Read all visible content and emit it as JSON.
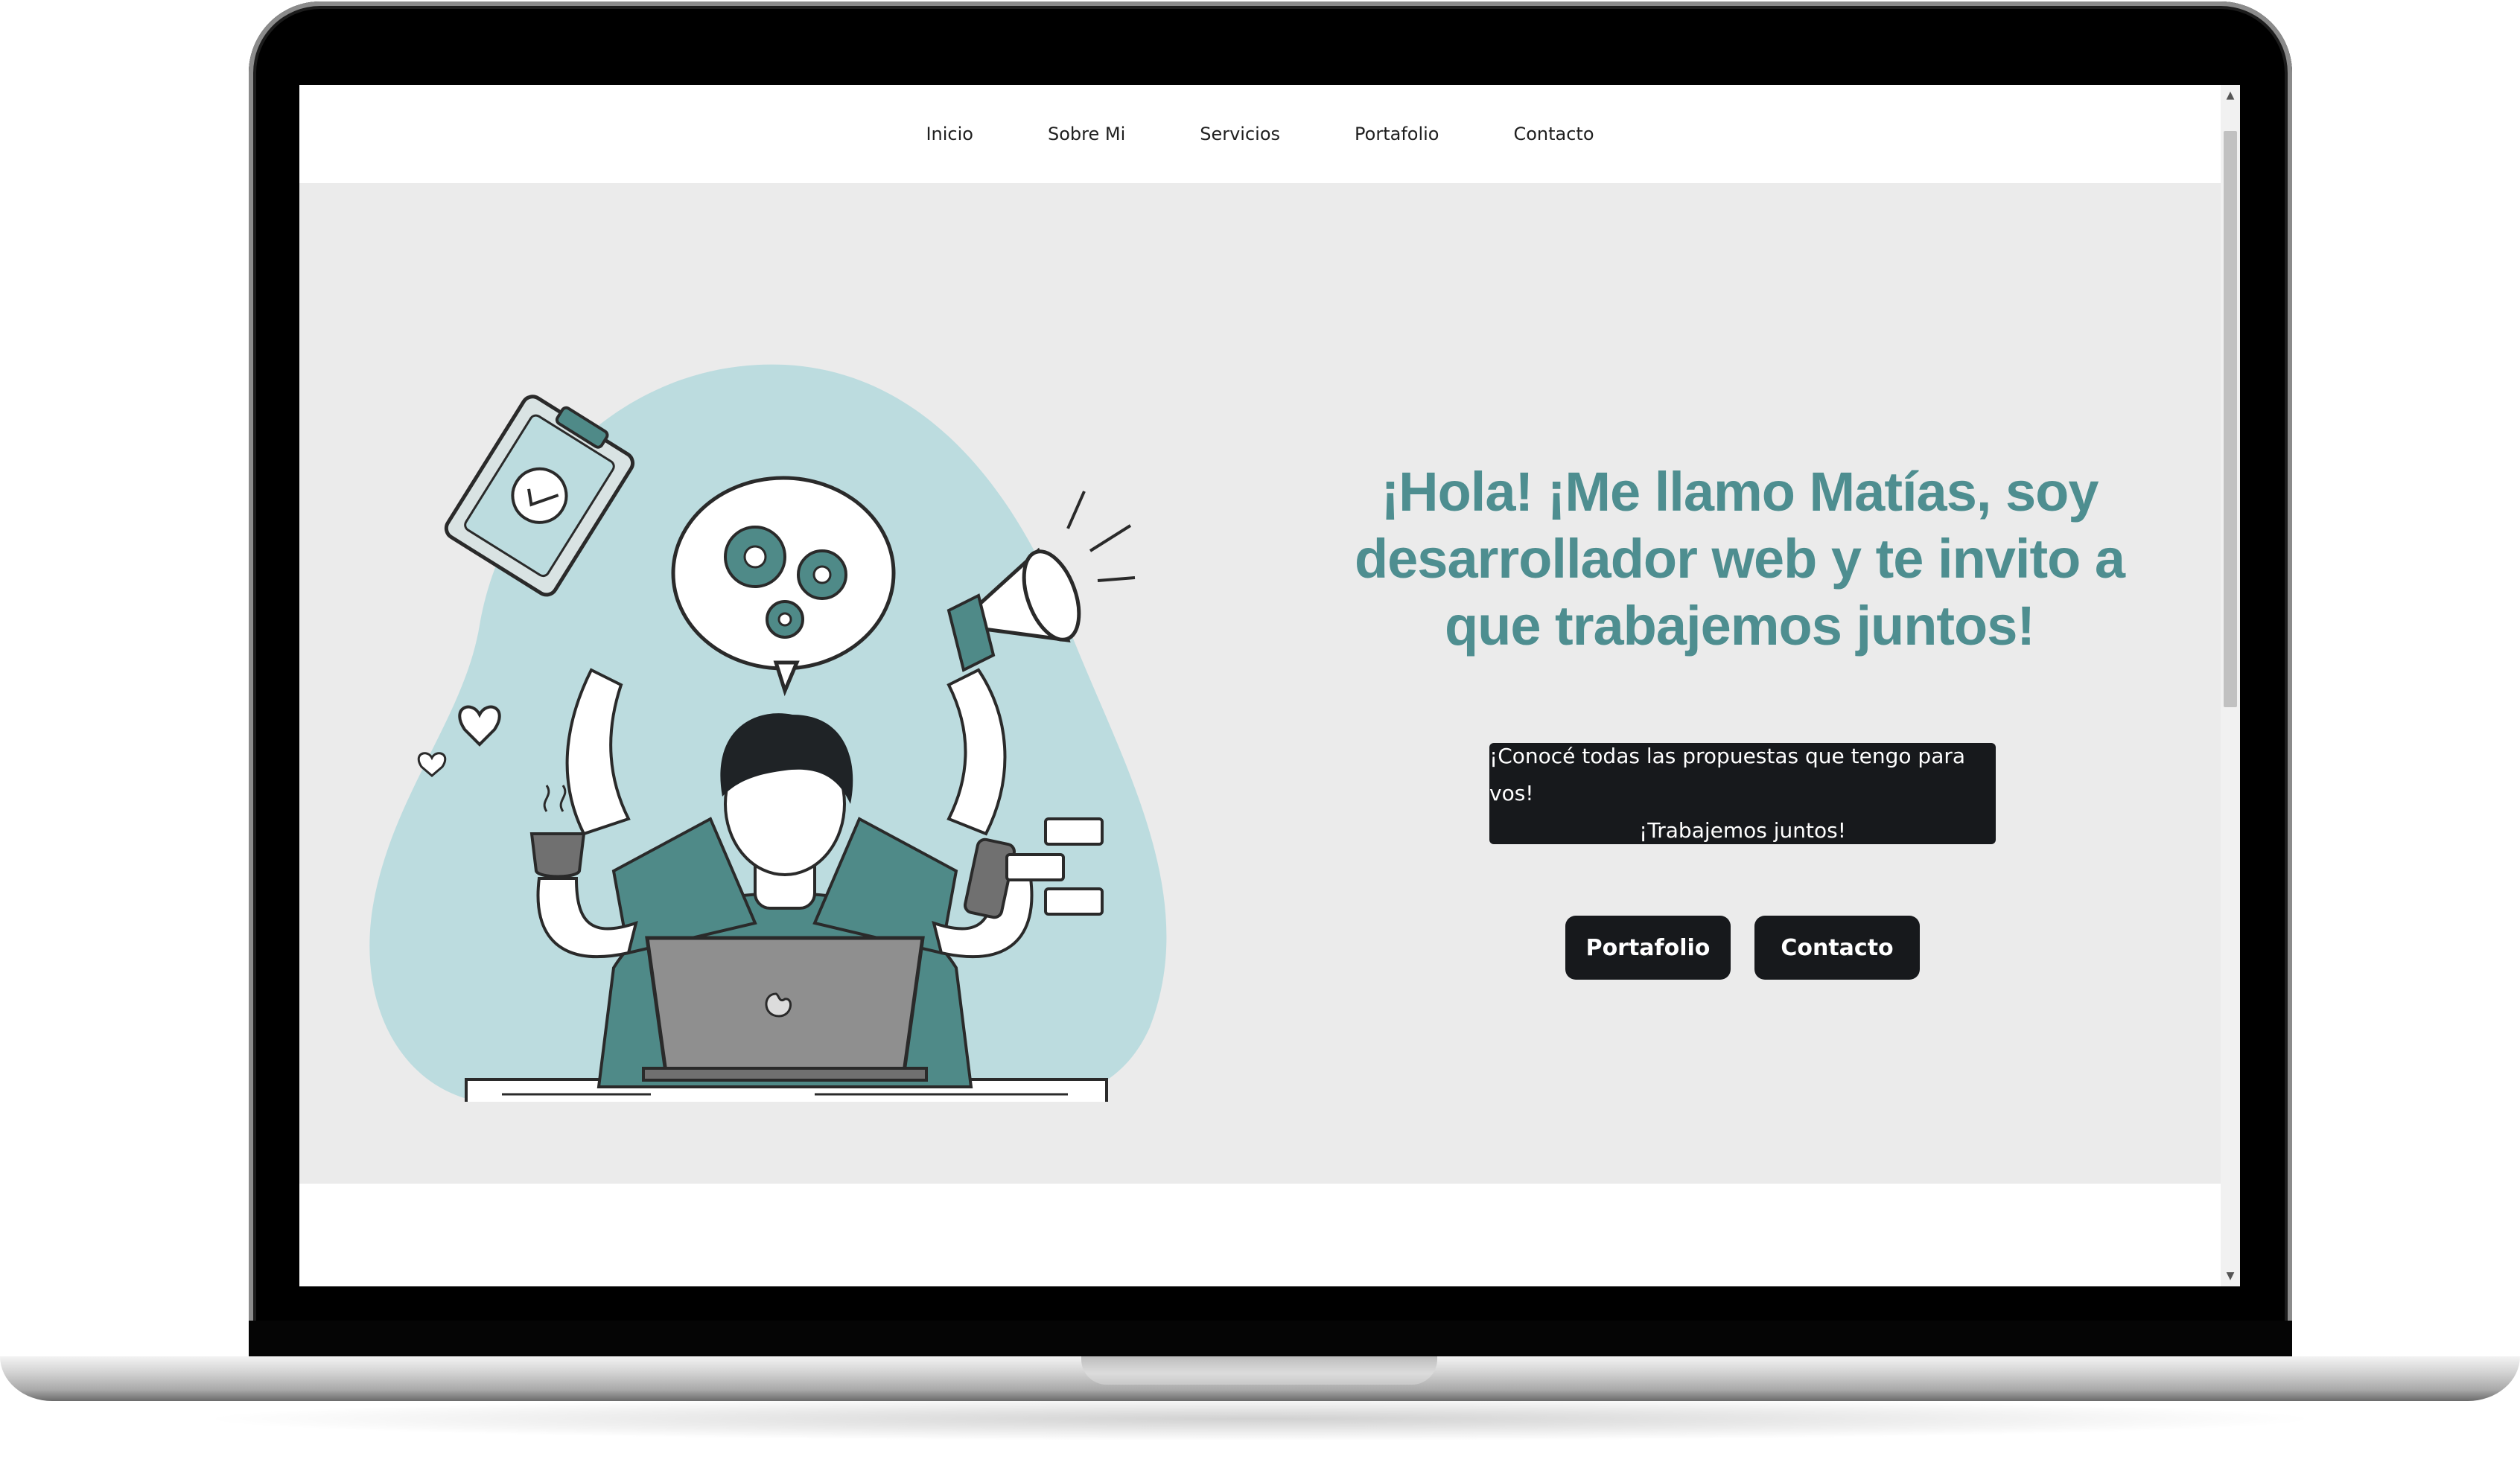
{
  "nav": {
    "items": [
      "Inicio",
      "Sobre Mi",
      "Servicios",
      "Portafolio",
      "Contacto"
    ]
  },
  "hero": {
    "headline_lines": [
      "¡Hola! ¡Me llamo Matías, soy",
      "desarrollador web y te invito a",
      "que trabajemos juntos!"
    ],
    "info_lines": [
      "¡Conocé todas las propuestas que tengo para vos!",
      "¡Trabajemos juntos!"
    ],
    "buttons": {
      "portfolio": "Portafolio",
      "contact": "Contacto"
    }
  },
  "scrollbar": {
    "up_glyph": "▲",
    "down_glyph": "▼"
  },
  "colors": {
    "accent": "#4e8e90",
    "illustration_teal": "#4f8a88",
    "blob": "#bcdcdf",
    "hero_bg": "#ebebeb",
    "dark": "#17191c"
  },
  "icons": {
    "illustration": "multitasking-developer-illustration"
  }
}
